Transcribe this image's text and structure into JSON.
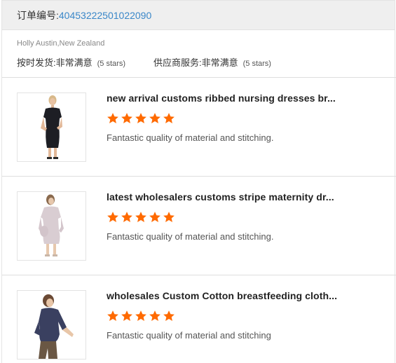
{
  "order": {
    "label": "订单编号:",
    "number": "40453222501022090"
  },
  "buyer": "Holly Austin,New Zealand",
  "ratings": [
    {
      "label": "按时发货:",
      "value": "非常满意",
      "note": "(5 stars)"
    },
    {
      "label": "供应商服务:",
      "value": "非常满意",
      "note": "(5 stars)"
    }
  ],
  "colors": {
    "star": "#ff6a00",
    "link": "#3a87c8",
    "header_bg": "#efefef"
  },
  "items": [
    {
      "title": "new arrival customs ribbed nursing dresses br...",
      "stars": 5,
      "review": "Fantastic quality of material and stitching.",
      "image_icon": "black-nursing-dress-photo"
    },
    {
      "title": "latest wholesalers customs stripe maternity dr...",
      "stars": 5,
      "review": "Fantastic quality of material and stitching.",
      "image_icon": "light-pink-maternity-dress-photo"
    },
    {
      "title": "wholesales Custom Cotton breastfeeding cloth...",
      "stars": 5,
      "review": "Fantastic quality of material and stitching",
      "image_icon": "navy-breastfeeding-top-photo"
    }
  ]
}
